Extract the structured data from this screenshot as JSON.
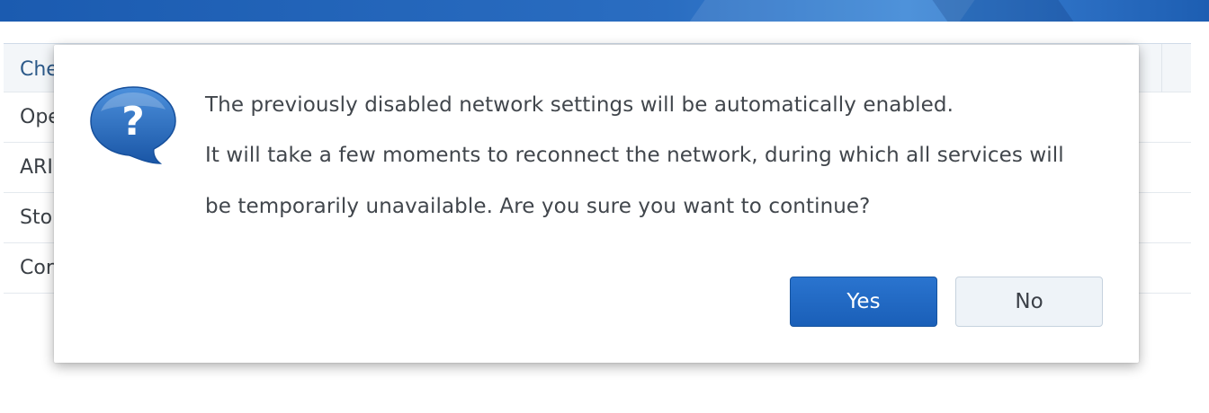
{
  "background_table": {
    "rows": [
      {
        "label": "Che"
      },
      {
        "label": "Ope"
      },
      {
        "label": "ARI"
      },
      {
        "label": "Sto"
      },
      {
        "label": "Cor"
      }
    ]
  },
  "dialog": {
    "icon": "question-bubble-icon",
    "message_lines": [
      "The previously disabled network settings will be automatically enabled.",
      "It will take a few moments to reconnect the network, during which all services will",
      "be temporarily unavailable. Are you sure you want to continue?"
    ],
    "buttons": {
      "yes_label": "Yes",
      "no_label": "No"
    }
  },
  "colors": {
    "header_banner": "#1b5bb0",
    "primary_button": "#1a5fb8",
    "secondary_button": "#eef3f8",
    "icon_blue": "#1f62b5"
  }
}
